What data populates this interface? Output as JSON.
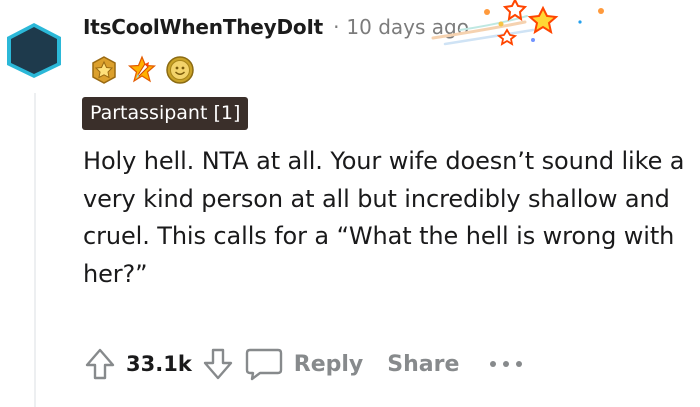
{
  "comment": {
    "username": "ItsCoolWhenTheyDoIt",
    "separator": "·",
    "timestamp": "10 days ago",
    "flair": "Partassipant [1]",
    "body": "Holy hell. NTA at all. Your wife doesn’t sound like a very kind person at all but incredibly shallow and cruel. This calls for a “What the hell is wrong with her?”",
    "awards": [
      "gold-star-award-icon",
      "rocket-star-award-icon",
      "gold-coin-award-icon"
    ],
    "avatar_color": "#1e3a4c",
    "avatar_border_color": "#24a0ed"
  },
  "actions": {
    "upvote_count": "33.1k",
    "reply_label": "Reply",
    "share_label": "Share"
  },
  "colors": {
    "flair_background": "#3a2f2a",
    "muted_text": "#878a8c"
  }
}
